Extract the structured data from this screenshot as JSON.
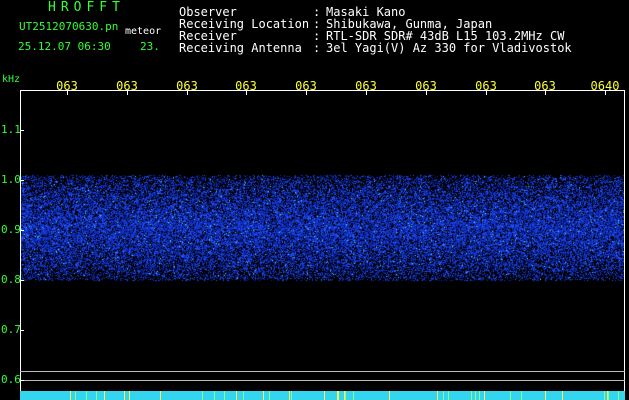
{
  "header": {
    "logo": "HROFFT",
    "file_name": "UT2512070630.pn",
    "tag": "meteor",
    "datetime": "25.12.07 06:30",
    "count": "23.",
    "info": [
      {
        "label": "Observer",
        "value": "Masaki Kano"
      },
      {
        "label": "Receiving Location",
        "value": "Shibukawa, Gunma, Japan"
      },
      {
        "label": "Receiver",
        "value": "RTL-SDR SDR# 43dB L15 103.2MHz CW"
      },
      {
        "label": "Receiving Antenna",
        "value": "3el Yagi(V) Az 330 for Vladivostok"
      }
    ]
  },
  "chart_data": {
    "type": "heatmap",
    "ylabel": "kHz",
    "x_tick_labels": [
      "063",
      "063",
      "063",
      "063",
      "063",
      "063",
      "063",
      "063",
      "063",
      "0640"
    ],
    "y_ticks": [
      1.1,
      1.0,
      0.9,
      0.8,
      0.7,
      0.6
    ],
    "ylim": [
      0.58,
      1.17
    ],
    "noise_band_khz": [
      0.8,
      1.01
    ],
    "reference_lines_khz": [
      0.618,
      0.6
    ],
    "colors": {
      "background": "#000000",
      "axis": "#ffffff",
      "label": "#33ff33",
      "time_label": "#ffff33",
      "signal": "#1a3cff",
      "signal_hot": "#33d6ee"
    }
  }
}
